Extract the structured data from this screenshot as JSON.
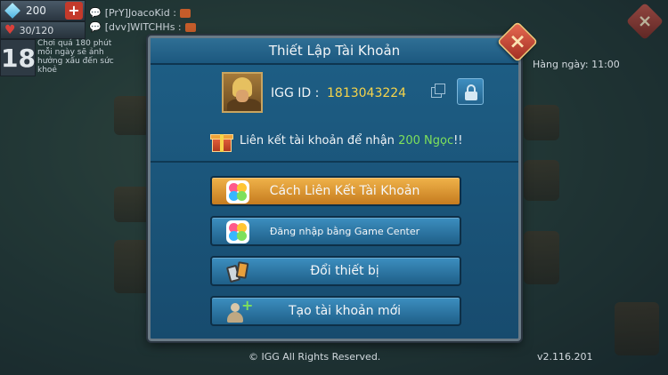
{
  "hud": {
    "gems": "200",
    "stamina": "30/120",
    "level": "18",
    "play_warning": "Chơi quá 180 phút mỗi ngày sẽ ảnh hưởng xấu đến sức khoẻ",
    "chat": [
      {
        "text": "[PrY]JoacoKid :"
      },
      {
        "text": "[dvv]WITCHHs :"
      }
    ],
    "right_text": "Hàng ngày: 11:00"
  },
  "dialog": {
    "title": "Thiết Lập Tài Khoản",
    "igg_label": "IGG ID :",
    "igg_id": "1813043224",
    "promo_prefix": "Liên kết tài khoản để nhận",
    "promo_reward": "200 Ngọc",
    "promo_suffix": "!!",
    "buttons": [
      {
        "label": "Cách Liên Kết Tài Khoản",
        "icon": "game-center-icon",
        "style": "gold"
      },
      {
        "label": "Đăng nhập bằng Game Center",
        "icon": "game-center-icon",
        "style": "blue"
      },
      {
        "label": "Đổi thiết bị",
        "icon": "device-switch-icon",
        "style": "blue"
      },
      {
        "label": "Tạo tài khoản mới",
        "icon": "add-user-icon",
        "style": "blue"
      }
    ]
  },
  "footer": {
    "copyright": "© IGG All Rights Reserved.",
    "version": "v2.116.201"
  },
  "colors": {
    "accent_gold": "#f7d44a",
    "highlight_green": "#7ee05b",
    "dialog_blue": "#1e5f86"
  }
}
